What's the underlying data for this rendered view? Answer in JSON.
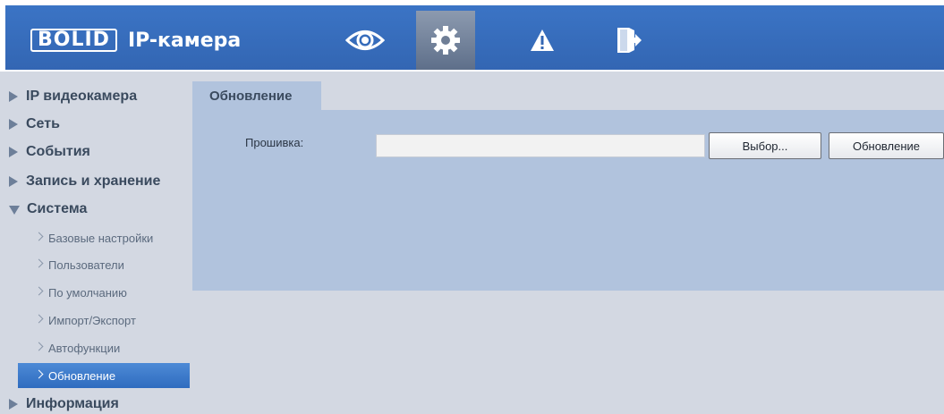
{
  "header": {
    "logo_text": "BOLID",
    "title": "IP-камера",
    "nav": [
      {
        "icon": "eye-icon",
        "active": false
      },
      {
        "icon": "gear-icon",
        "active": true
      },
      {
        "icon": "warning-icon",
        "active": false
      },
      {
        "icon": "logout-icon",
        "active": false
      }
    ]
  },
  "sidebar": {
    "items": [
      {
        "label": "IP видеокамера",
        "expanded": false
      },
      {
        "label": "Сеть",
        "expanded": false
      },
      {
        "label": "События",
        "expanded": false
      },
      {
        "label": "Запись и хранение",
        "expanded": false
      },
      {
        "label": "Система",
        "expanded": true
      },
      {
        "label": "Информация",
        "expanded": false
      }
    ],
    "system_subitems": [
      {
        "label": "Базовые настройки",
        "active": false
      },
      {
        "label": "Пользователи",
        "active": false
      },
      {
        "label": "По умолчанию",
        "active": false
      },
      {
        "label": "Импорт/Экспорт",
        "active": false
      },
      {
        "label": "Автофункции",
        "active": false
      },
      {
        "label": "Обновление",
        "active": true
      }
    ]
  },
  "main": {
    "tab_label": "Обновление",
    "firmware_label": "Прошивка:",
    "firmware_value": "",
    "select_button": "Выбор...",
    "update_button": "Обновление"
  },
  "colors": {
    "header": "#3366b3",
    "panel": "#b1c3dd",
    "background": "#d3d8e2",
    "active_item": "#2f6cbf"
  }
}
